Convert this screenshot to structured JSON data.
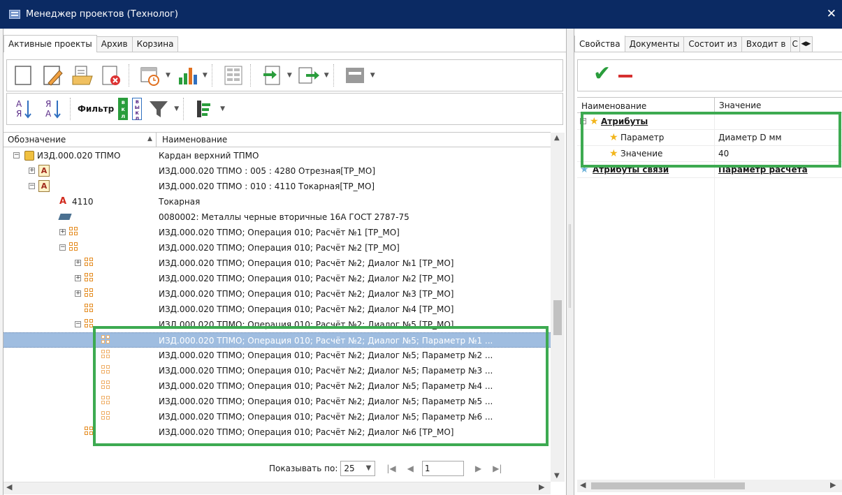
{
  "window": {
    "title": "Менеджер проектов (Технолог)",
    "close_glyph": "✕"
  },
  "left_tabs": [
    {
      "label": "Активные проекты",
      "active": true
    },
    {
      "label": "Архив",
      "active": false
    },
    {
      "label": "Корзина",
      "active": false
    }
  ],
  "toolbar1_icons": [
    "new-document-icon",
    "edit-document-icon",
    "open-folder-icon",
    "delete-document-icon",
    "calendar-clock-icon",
    "bar-chart-icon",
    "view-grid-icon",
    "import-icon",
    "export-icon",
    "properties-icon"
  ],
  "toolbar2": {
    "sort_az": "А Я",
    "sort_za": "Я А",
    "filter_label": "Фильтр",
    "filter_on_badge": "вкл",
    "filter_on_badge2": "выкл"
  },
  "tree_header": {
    "col1": "Обозначение",
    "col2": "Наименование",
    "sort_indicator": "▲"
  },
  "tree_rows": [
    {
      "code": "ИЗД.000.020 ТПМО",
      "name": "Кардан верхний ТПМО"
    },
    {
      "code": "",
      "name": "ИЗД.000.020 ТПМО : 005 : 4280 Отрезная[ТР_МО]"
    },
    {
      "code": "",
      "name": "ИЗД.000.020 ТПМО : 010 : 4110 Токарная[ТР_МО]"
    },
    {
      "code": "4110",
      "name": "Токарная"
    },
    {
      "code": "",
      "name": "0080002: Металлы черные вторичные 16А ГОСТ 2787-75"
    },
    {
      "code": "",
      "name": "ИЗД.000.020 ТПМО; Операция 010; Расчёт №1 [ТР_МО]"
    },
    {
      "code": "",
      "name": "ИЗД.000.020 ТПМО; Операция 010; Расчёт №2 [ТР_МО]"
    },
    {
      "code": "",
      "name": "ИЗД.000.020 ТПМО; Операция 010; Расчёт №2; Диалог №1 [ТР_МО]"
    },
    {
      "code": "",
      "name": "ИЗД.000.020 ТПМО; Операция 010; Расчёт №2; Диалог №2 [ТР_МО]"
    },
    {
      "code": "",
      "name": "ИЗД.000.020 ТПМО; Операция 010; Расчёт №2; Диалог №3 [ТР_МО]"
    },
    {
      "code": "",
      "name": "ИЗД.000.020 ТПМО; Операция 010; Расчёт №2; Диалог №4 [ТР_МО]"
    },
    {
      "code": "",
      "name": "ИЗД.000.020 ТПМО; Операция 010; Расчёт №2; Диалог №5 [ТР_МО]"
    },
    {
      "code": "",
      "name": "ИЗД.000.020 ТПМО; Операция 010; Расчёт №2; Диалог №5; Параметр №1 ..."
    },
    {
      "code": "",
      "name": "ИЗД.000.020 ТПМО; Операция 010; Расчёт №2; Диалог №5; Параметр №2 ..."
    },
    {
      "code": "",
      "name": "ИЗД.000.020 ТПМО; Операция 010; Расчёт №2; Диалог №5; Параметр №3 ..."
    },
    {
      "code": "",
      "name": "ИЗД.000.020 ТПМО; Операция 010; Расчёт №2; Диалог №5; Параметр №4 ..."
    },
    {
      "code": "",
      "name": "ИЗД.000.020 ТПМО; Операция 010; Расчёт №2; Диалог №5; Параметр №5 ..."
    },
    {
      "code": "",
      "name": "ИЗД.000.020 ТПМО; Операция 010; Расчёт №2; Диалог №5; Параметр №6 ..."
    },
    {
      "code": "",
      "name": "ИЗД.000.020 ТПМО; Операция 010; Расчёт №2; Диалог №6 [ТР_МО]"
    }
  ],
  "pager": {
    "label": "Показывать по:",
    "page_size": "25",
    "page": "1"
  },
  "right_tabs": [
    {
      "label": "Свойства",
      "active": true
    },
    {
      "label": "Документы",
      "active": false
    },
    {
      "label": "Состоит из",
      "active": false
    },
    {
      "label": "Входит в",
      "active": false
    },
    {
      "label": "С",
      "active": false
    }
  ],
  "props": {
    "col1": "Наименование",
    "col2": "Значение",
    "group_attrs": "Атрибуты",
    "param_label": "Параметр",
    "param_value": "Диаметр D мм",
    "value_label": "Значение",
    "value_value": "40",
    "link_group": "Атрибуты связи",
    "link_value": "Параметр расчёта"
  },
  "colors": {
    "titlebar": "#0b2a63",
    "selection": "#9fbde0",
    "highlight_box": "#3daa51",
    "accept": "#2a9d3c",
    "reject": "#d63030"
  }
}
